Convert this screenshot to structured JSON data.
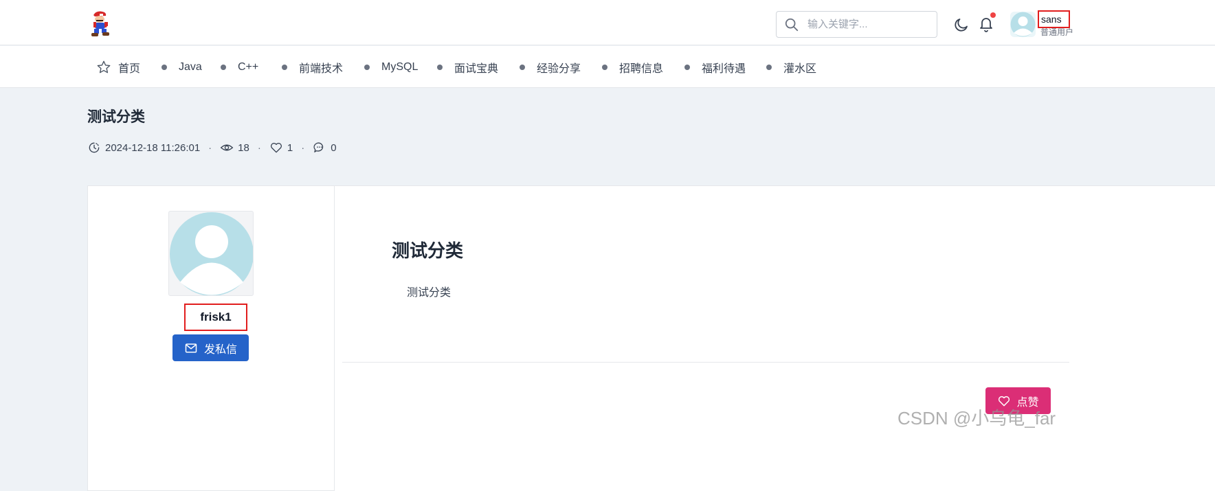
{
  "header": {
    "search": {
      "placeholder": "输入关键字..."
    },
    "user": {
      "name": "sans",
      "role": "普通用户"
    }
  },
  "nav": {
    "items": [
      {
        "label": "首页"
      },
      {
        "label": "Java"
      },
      {
        "label": "C++"
      },
      {
        "label": "前端技术"
      },
      {
        "label": "MySQL"
      },
      {
        "label": "面试宝典"
      },
      {
        "label": "经验分享"
      },
      {
        "label": "招聘信息"
      },
      {
        "label": "福利待遇"
      },
      {
        "label": "灌水区"
      }
    ]
  },
  "post": {
    "title": "测试分类",
    "time": "2024-12-18 11:26:01",
    "views": "18",
    "likes": "1",
    "comments": "0",
    "separator": "·"
  },
  "author": {
    "name": "frisk1",
    "message_button": "发私信"
  },
  "content": {
    "title": "测试分类",
    "body": "测试分类",
    "like_button": "点赞"
  },
  "watermark": "CSDN @小乌龟_far",
  "colors": {
    "primary": "#2563c9",
    "like": "#db2e76",
    "highlight_border": "#e11d1d",
    "notification_dot": "#ef4444",
    "avatar": "#b7dfe8"
  }
}
